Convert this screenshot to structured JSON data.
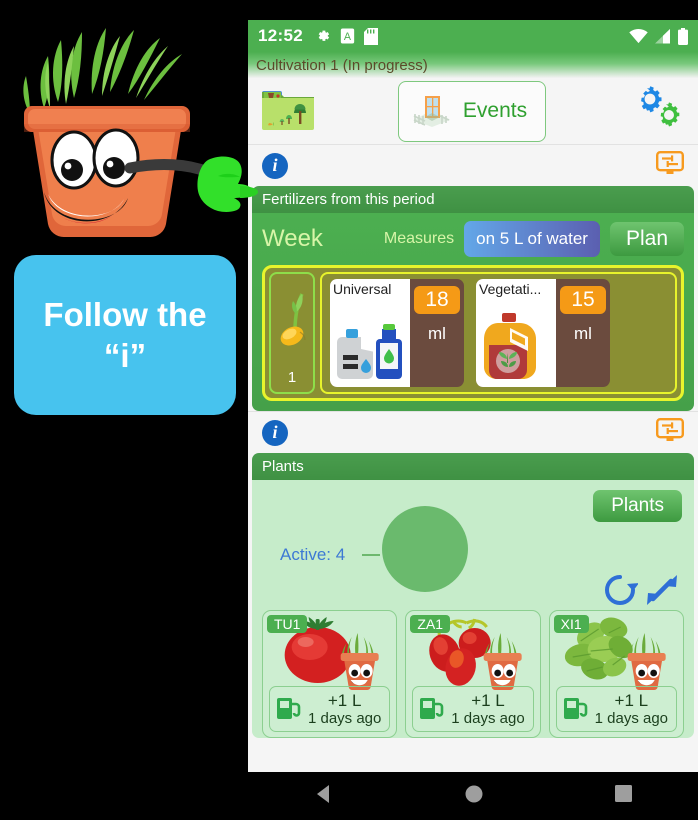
{
  "statusbar": {
    "clock": "12:52",
    "icons_left": [
      "gear-icon",
      "a-badge-icon",
      "sd-card-icon"
    ],
    "icons_right": [
      "wifi-icon",
      "cell-signal-icon",
      "battery-icon"
    ],
    "background": "#4caf50"
  },
  "titlebar": {
    "text": "Cultivation 1 (In progress)"
  },
  "toolbar": {
    "folder_icon": "cultivation-folder-icon",
    "events_label": "Events",
    "events_icon": "greenhouse-icon",
    "settings_icon": "gears-icon"
  },
  "info_rows": {
    "info_icon": "info-icon",
    "display_icon": "display-settings-icon"
  },
  "fertilizer_card": {
    "header": "Fertilizers from this period",
    "week_label": "Week",
    "measures_label": "Measures",
    "water_button": "on 5 L of water",
    "plan_button": "Plan",
    "stage": {
      "icon": "sprouting-seed-icon",
      "number": "1"
    },
    "items": [
      {
        "name": "Universal",
        "icon": "fertilizer-bottles-icon",
        "qty": "18",
        "unit": "ml"
      },
      {
        "name": "Vegetati...",
        "icon": "fertilizer-jug-icon",
        "qty": "15",
        "unit": "ml"
      }
    ]
  },
  "plants_card": {
    "header": "Plants",
    "plants_button": "Plants",
    "active_label": "Active: 4",
    "refresh_icon": "refresh-icon",
    "expand_icon": "expand-icon",
    "plants": [
      {
        "tag": "TU1",
        "art": "tomato-icon",
        "water": "+1 L",
        "ago": "1 days ago",
        "fuel_icon": "watering-icon"
      },
      {
        "tag": "ZA1",
        "art": "cherry-tomato-icon",
        "water": "+1 L",
        "ago": "1 days ago",
        "fuel_icon": "watering-icon"
      },
      {
        "tag": "XI1",
        "art": "basil-icon",
        "water": "+1 L",
        "ago": "1 days ago",
        "fuel_icon": "watering-icon"
      }
    ]
  },
  "navbar": {
    "back": "back-triangle-icon",
    "home": "home-circle-icon",
    "recents": "recents-square-icon"
  },
  "overlay": {
    "mascot": "flower-pot-mascot-icon",
    "hand": "pointing-hand-icon",
    "bubble_line1": "Follow the",
    "bubble_line2": "“i”",
    "bubble_color": "#47c3ee"
  }
}
